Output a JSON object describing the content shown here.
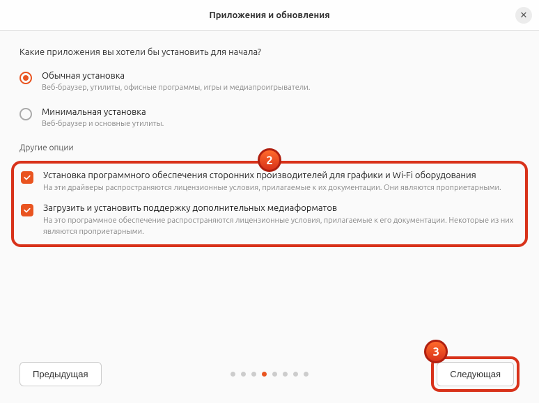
{
  "titlebar": {
    "title": "Приложения и обновления"
  },
  "heading": "Какие приложения вы хотели бы установить для начала?",
  "install_options": [
    {
      "title": "Обычная установка",
      "desc": "Веб-браузер, утилиты, офисные программы, игры и медиапроигрыватели.",
      "checked": true
    },
    {
      "title": "Минимальная установка",
      "desc": "Веб-браузер и основные утилиты.",
      "checked": false
    }
  ],
  "other_label": "Другие опции",
  "checkboxes": [
    {
      "title": "Установка программного обеспечения сторонних производителей для графики и Wi-Fi оборудования",
      "desc": "На эти драйверы распространяются лицензионные условия, прилагаемые к их документации. Они являются проприетарными."
    },
    {
      "title": "Загрузить и установить поддержку дополнительных медиаформатов",
      "desc": "На это программное обеспечение распространяются лицензионные условия, прилагаемые к его документации. Некоторые из них являются проприетарными."
    }
  ],
  "footer": {
    "prev": "Предыдущая",
    "next": "Следующая"
  },
  "markers": {
    "two": "2",
    "three": "3"
  },
  "progress": {
    "total": 8,
    "active": 3
  }
}
